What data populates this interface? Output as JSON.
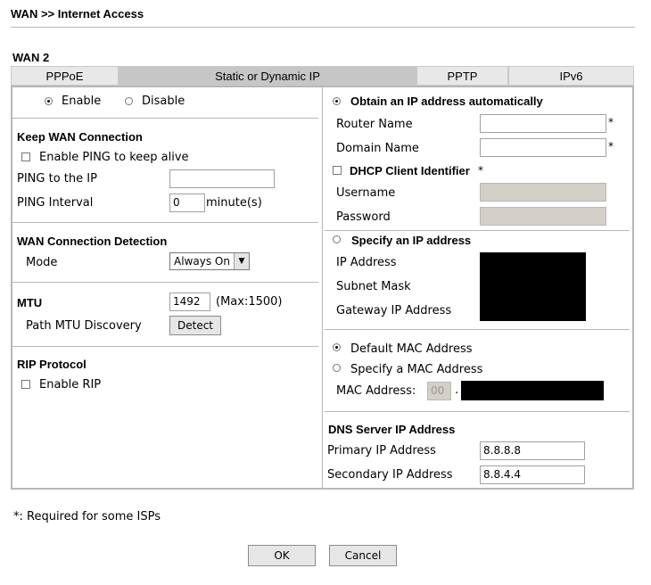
{
  "page": {
    "title": "WAN >> Internet Access",
    "wan_label": "WAN 2",
    "footnote": "*: Required for some ISPs",
    "ok_label": "OK",
    "cancel_label": "Cancel"
  },
  "tabs": [
    {
      "label": "PPPoE",
      "active": false
    },
    {
      "label": "Static or Dynamic IP",
      "active": true
    },
    {
      "label": "PPTP",
      "active": false
    },
    {
      "label": "IPv6",
      "active": false
    }
  ],
  "left": {
    "enable_label": "Enable",
    "disable_label": "Disable",
    "enable_selected": true,
    "keep_wan": {
      "header": "Keep WAN Connection",
      "ping_keepalive_label": "Enable PING to keep alive",
      "ping_keepalive_checked": false,
      "ping_ip_label": "PING to the IP",
      "ping_ip_value": "",
      "ping_interval_label": "PING Interval",
      "ping_interval_value": "0",
      "ping_interval_unit": "minute(s)"
    },
    "detection": {
      "header": "WAN Connection Detection",
      "mode_label": "Mode",
      "mode_value": "Always On"
    },
    "mtu": {
      "header": "MTU",
      "value": "1492",
      "max_note": "(Max:1500)",
      "path_mtu_label": "Path MTU Discovery",
      "detect_label": "Detect"
    },
    "rip": {
      "header": "RIP Protocol",
      "enable_label": "Enable RIP",
      "checked": false
    }
  },
  "right": {
    "obtain_auto_label": "Obtain an IP address automatically",
    "obtain_auto_selected": true,
    "router_name_label": "Router Name",
    "router_name_value": "",
    "domain_name_label": "Domain Name",
    "domain_name_value": "",
    "required_mark": "*",
    "dhcp_client_id_label": "DHCP Client Identifier",
    "dhcp_client_id_checked": false,
    "username_label": "Username",
    "password_label": "Password",
    "specify_ip_label": "Specify an IP address",
    "ip_address_label": "IP Address",
    "subnet_mask_label": "Subnet Mask",
    "gateway_label": "Gateway IP Address",
    "default_mac_label": "Default MAC Address",
    "default_mac_selected": true,
    "specify_mac_label": "Specify a MAC Address",
    "mac_address_label": "MAC Address:",
    "mac_first_octet": "00",
    "mac_separator": ".",
    "dns": {
      "header": "DNS Server IP Address",
      "primary_label": "Primary IP Address",
      "primary_value": "8.8.8.8",
      "secondary_label": "Secondary IP Address",
      "secondary_value": "8.8.4.4"
    }
  }
}
